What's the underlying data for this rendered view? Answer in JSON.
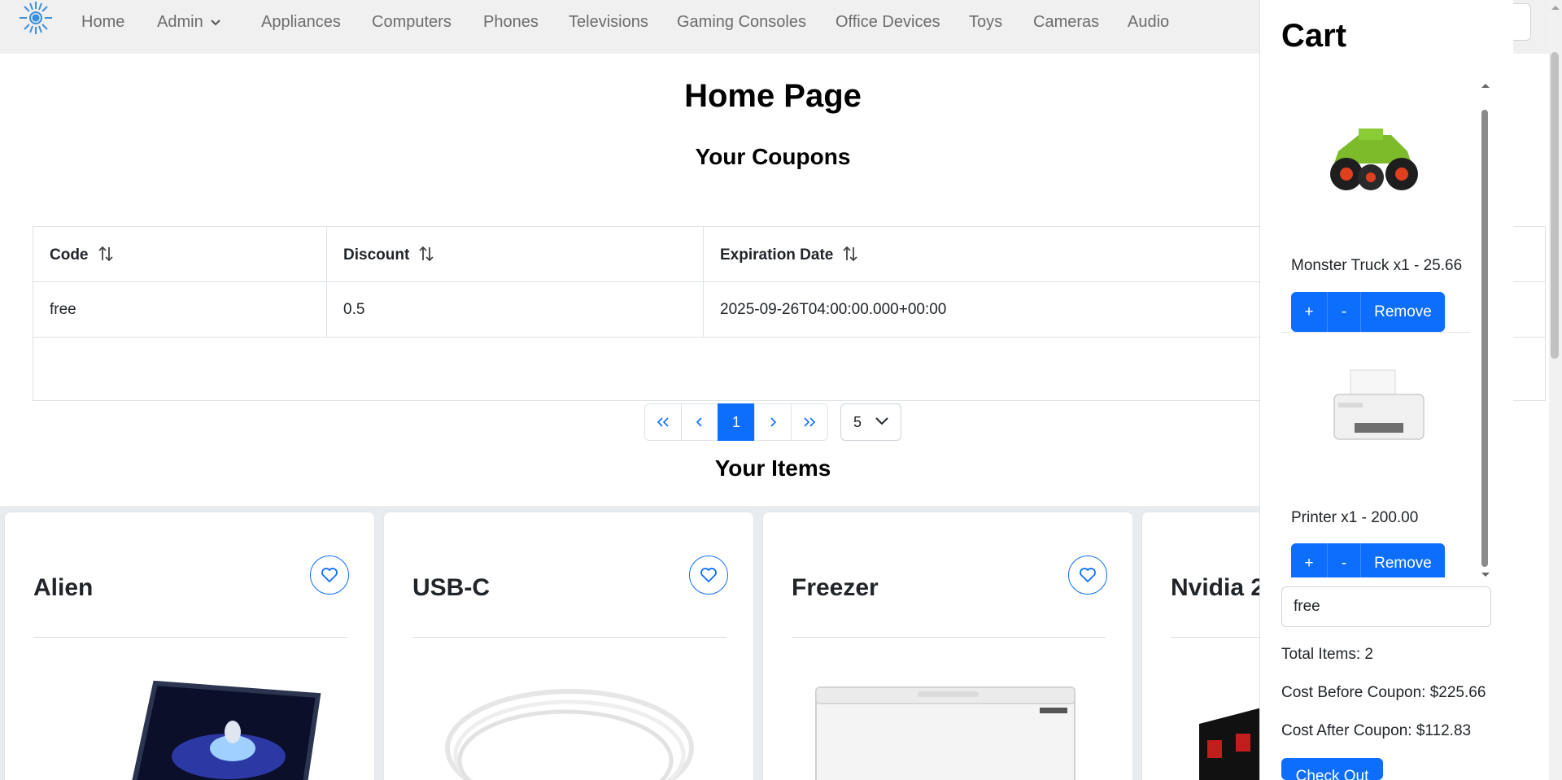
{
  "navbar": {
    "items": [
      {
        "label": "Home"
      },
      {
        "label": "Admin"
      },
      {
        "label": "Appliances"
      },
      {
        "label": "Computers"
      },
      {
        "label": "Phones"
      },
      {
        "label": "Televisions"
      },
      {
        "label": "Gaming Consoles"
      },
      {
        "label": "Office Devices"
      },
      {
        "label": "Toys"
      },
      {
        "label": "Cameras"
      },
      {
        "label": "Audio"
      }
    ]
  },
  "main": {
    "title": "Home Page",
    "coupons_title": "Your Coupons",
    "coupon_table": {
      "headers": [
        "Code",
        "Discount",
        "Expiration Date"
      ],
      "rows": [
        [
          "free",
          "0.5",
          "2025-09-26T04:00:00.000+00:00"
        ]
      ]
    },
    "pager": {
      "first": "«",
      "prev": "‹",
      "current": "1",
      "next": "›",
      "last": "»",
      "page_size": "5"
    },
    "items_title": "Your Items",
    "items": [
      {
        "name": "Alien"
      },
      {
        "name": "USB-C"
      },
      {
        "name": "Freezer"
      },
      {
        "name": "Nvidia 2"
      }
    ]
  },
  "cart": {
    "title": "Cart",
    "items": [
      {
        "label": "Monster Truck x1 - 25.66"
      },
      {
        "label": "Printer x1 - 200.00"
      }
    ],
    "buttons": {
      "plus": "+",
      "minus": "-",
      "remove": "Remove"
    },
    "coupon_value": "free",
    "total_items": "Total Items: 2",
    "cost_before": "Cost Before Coupon: $225.66",
    "cost_after": "Cost After Coupon: $112.83",
    "checkout": "Check Out"
  },
  "colors": {
    "primary": "#0d6efd",
    "navbar_bg": "#f0f0f0",
    "items_bg": "#e9ecef"
  },
  "icons": [
    "sun-logo-icon",
    "chevron-down-icon",
    "sort-icon",
    "heart-icon"
  ]
}
